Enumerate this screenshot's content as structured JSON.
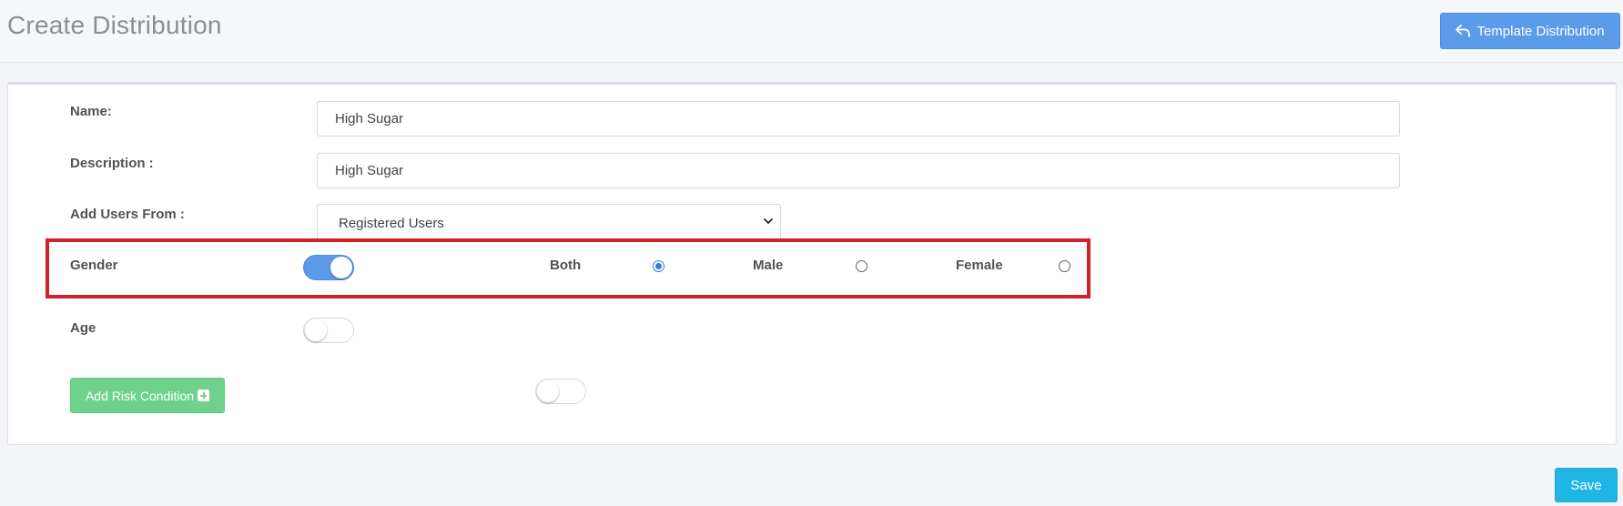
{
  "header": {
    "title": "Create Distribution",
    "template_button_label": "Template Distribution"
  },
  "form": {
    "name": {
      "label": "Name:",
      "value": "High Sugar"
    },
    "description": {
      "label": "Description :",
      "value": "High Sugar"
    },
    "add_users_from": {
      "label": "Add Users From :",
      "selected": "Registered Users"
    },
    "gender": {
      "label": "Gender",
      "toggle_on": true,
      "options": [
        {
          "label": "Both",
          "checked": true
        },
        {
          "label": "Male",
          "checked": false
        },
        {
          "label": "Female",
          "checked": false
        }
      ]
    },
    "age": {
      "label": "Age",
      "toggle_on": false
    },
    "risk": {
      "button_label": "Add Risk Condition",
      "toggle_on": false
    }
  },
  "footer": {
    "save_label": "Save"
  },
  "colors": {
    "primary": "#5b9bea",
    "success": "#6fd18b",
    "info": "#1fb5e5",
    "highlight": "#d0202a"
  }
}
